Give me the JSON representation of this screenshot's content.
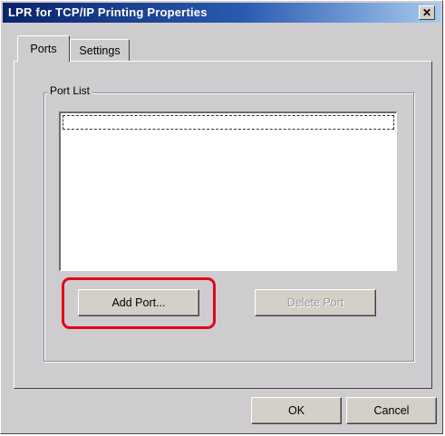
{
  "window": {
    "title": "LPR for TCP/IP Printing Properties",
    "close_glyph": "✕"
  },
  "tabs": [
    {
      "label": "Ports",
      "selected": true
    },
    {
      "label": "Settings",
      "selected": false
    }
  ],
  "port_list": {
    "group_label": "Port List",
    "items": []
  },
  "buttons": {
    "add_port": "Add Port...",
    "delete_port": "Delete Port",
    "ok": "OK",
    "cancel": "Cancel"
  },
  "annotation": {
    "highlight_color": "#e3051b"
  },
  "colors": {
    "dialog_face": "#cfccd0",
    "titlebar_start": "#0a246a",
    "titlebar_end": "#a6caf0"
  }
}
